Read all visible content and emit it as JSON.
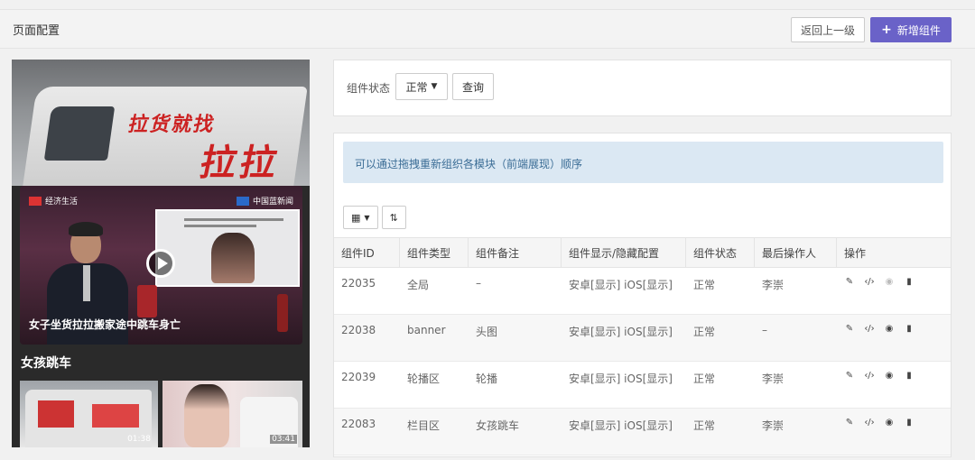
{
  "header": {
    "title": "页面配置",
    "back_label": "返回上一级",
    "add_label": "新增组件",
    "add_icon": "plus-icon"
  },
  "preview": {
    "van_text_small": "拉货就找",
    "van_text_big": "拉拉",
    "video_logo_left": "经济生活",
    "video_logo_right": "中国蓝新闻",
    "video_caption": "女子坐货拉拉搬家途中跳车身亡",
    "section_title": "女孩跳车",
    "thumbs": [
      {
        "duration": "01:38"
      },
      {
        "duration": "03:41"
      }
    ]
  },
  "filter": {
    "label": "组件状态",
    "selected": "正常",
    "query_label": "查询"
  },
  "notice": "可以通过拖拽重新组织各模块（前端展现）顺序",
  "toolbar": {
    "grid_icon": "grid-icon",
    "sort_icon": "sort-icon"
  },
  "table": {
    "headers": [
      "组件ID",
      "组件类型",
      "组件备注",
      "组件显示/隐藏配置",
      "组件状态",
      "最后操作人",
      "操作"
    ],
    "rows": [
      {
        "id": "22035",
        "type": "全局",
        "note": "–",
        "visibility": "安卓[显示] iOS[显示]",
        "status": "正常",
        "operator": "李崇"
      },
      {
        "id": "22038",
        "type": "banner",
        "note": "头图",
        "visibility": "安卓[显示] iOS[显示]",
        "status": "正常",
        "operator": "–"
      },
      {
        "id": "22039",
        "type": "轮播区",
        "note": "轮播",
        "visibility": "安卓[显示] iOS[显示]",
        "status": "正常",
        "operator": "李崇"
      },
      {
        "id": "22083",
        "type": "栏目区",
        "note": "女孩跳车",
        "visibility": "安卓[显示] iOS[显示]",
        "status": "正常",
        "operator": "李崇"
      }
    ],
    "action_icons": [
      "edit-icon",
      "code-icon",
      "eye-icon",
      "trash-icon"
    ]
  },
  "colors": {
    "accent": "#6a62c8",
    "notice_bg": "#dbe8f3",
    "notice_text": "#3b6d96"
  }
}
